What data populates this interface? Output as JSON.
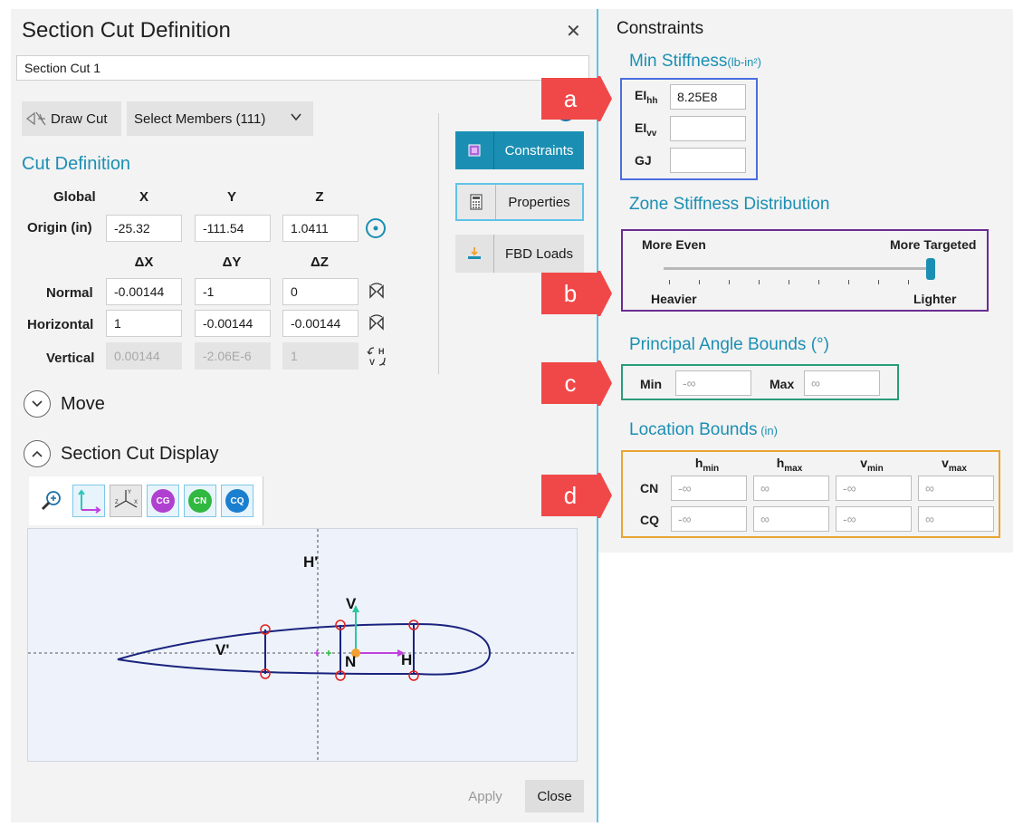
{
  "dialog": {
    "title": "Section Cut Definition",
    "close_glyph": "✕",
    "name_value": "Section Cut 1"
  },
  "toolbar": {
    "draw_cut_label": "Draw Cut",
    "select_members_label": "Select Members (111)"
  },
  "cut_definition": {
    "heading": "Cut Definition",
    "col_global": "Global",
    "col_x": "X",
    "col_y": "Y",
    "col_z": "Z",
    "origin_label": "Origin (in)",
    "origin": [
      "-25.32",
      "-111.54",
      "1.0411"
    ],
    "col_dx": "ΔX",
    "col_dy": "ΔY",
    "col_dz": "ΔZ",
    "normal_label": "Normal",
    "normal": [
      "-0.00144",
      "-1",
      "0"
    ],
    "horizontal_label": "Horizontal",
    "horizontal": [
      "1",
      "-0.00144",
      "-0.00144"
    ],
    "vertical_label": "Vertical",
    "vertical": [
      "0.00144",
      "-2.06E-6",
      "1"
    ]
  },
  "side_buttons": {
    "constraints": "Constraints",
    "properties": "Properties",
    "fbd_loads": "FBD Loads"
  },
  "sections": {
    "move": "Move",
    "section_cut_display": "Section Cut Display"
  },
  "display_tools": {
    "cg": "CG",
    "cn": "CN",
    "cq": "CQ"
  },
  "canvas": {
    "h_prime": "H'",
    "v_prime": "V'",
    "v": "V",
    "n": "N",
    "h": "H"
  },
  "footer": {
    "apply": "Apply",
    "close": "Close"
  },
  "constraints": {
    "title": "Constraints",
    "min_stiffness_heading": "Min Stiffness",
    "min_stiffness_unit": "(lb-in²)",
    "ei_hh_label": "EI",
    "ei_hh_sub": "hh",
    "ei_hh_value": "8.25E8",
    "ei_vv_label": "EI",
    "ei_vv_sub": "vv",
    "ei_vv_value": "",
    "gj_label": "GJ",
    "gj_value": "",
    "zone_heading": "Zone Stiffness Distribution",
    "more_even": "More Even",
    "more_targeted": "More Targeted",
    "heavier": "Heavier",
    "lighter": "Lighter",
    "slider_fraction": 1.0,
    "principal_heading": "Principal Angle Bounds (°)",
    "min_label": "Min",
    "min_placeholder": "-∞",
    "max_label": "Max",
    "max_placeholder": "∞",
    "location_heading": "Location Bounds",
    "location_unit": "(in)",
    "h_min": "h",
    "h_min_sub": "min",
    "h_max": "h",
    "h_max_sub": "max",
    "v_min": "v",
    "v_min_sub": "min",
    "v_max": "v",
    "v_max_sub": "max",
    "cn_label": "CN",
    "cq_label": "CQ",
    "neg_inf": "-∞",
    "pos_inf": "∞"
  },
  "callouts": [
    "a",
    "b",
    "c",
    "d"
  ],
  "colors": {
    "accent_teal": "#1b8fb3",
    "callout_red": "#f04848",
    "box_a": "#4a6ee0",
    "box_b": "#6a2c91",
    "box_c": "#2a9d7a",
    "box_d": "#e8a530"
  }
}
